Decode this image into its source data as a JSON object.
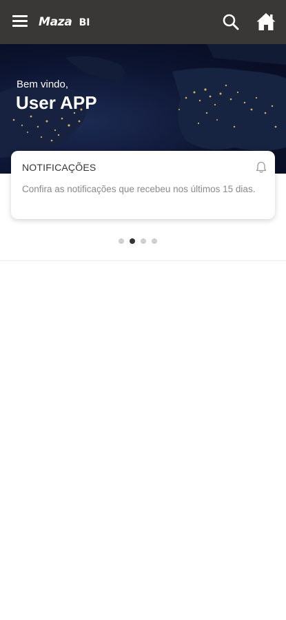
{
  "topbar": {
    "logo_main": "Maza",
    "logo_sub": "BI",
    "menu_icon": "hamburger-menu-icon",
    "search_icon": "search-icon",
    "home_icon": "home-icon",
    "background_color": "#3a3836"
  },
  "hero": {
    "welcome": "Bem vindo,",
    "username": "User APP"
  },
  "notification_card": {
    "title": "NOTIFICAÇÕES",
    "description": "Confira as notificações que recebeu nos últimos 15 dias.",
    "icon": "bell-icon"
  },
  "carousel": {
    "count": 4,
    "active_index": 1
  }
}
